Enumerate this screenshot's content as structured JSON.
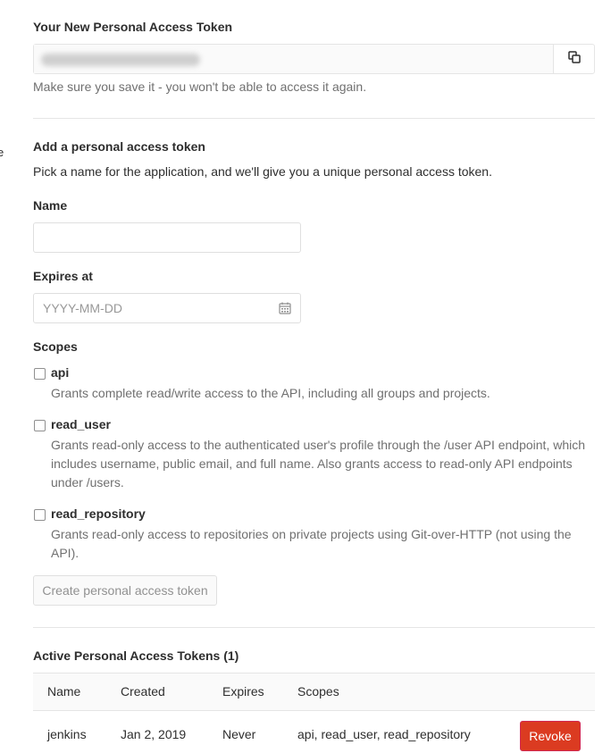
{
  "left_edge_text": "e",
  "new_token": {
    "title": "Your New Personal Access Token",
    "hint": "Make sure you save it - you won't be able to access it again."
  },
  "add_token": {
    "title": "Add a personal access token",
    "description": "Pick a name for the application, and we'll give you a unique personal access token.",
    "name_label": "Name",
    "name_value": "",
    "expires_label": "Expires at",
    "expires_placeholder": "YYYY-MM-DD",
    "scopes_label": "Scopes",
    "scopes": [
      {
        "name": "api",
        "description": "Grants complete read/write access to the API, including all groups and projects."
      },
      {
        "name": "read_user",
        "description": "Grants read-only access to the authenticated user's profile through the /user API endpoint, which includes username, public email, and full name. Also grants access to read-only API endpoints under /users."
      },
      {
        "name": "read_repository",
        "description": "Grants read-only access to repositories on private projects using Git-over-HTTP (not using the API)."
      }
    ],
    "create_button": "Create personal access token"
  },
  "active_tokens": {
    "title": "Active Personal Access Tokens (1)",
    "columns": [
      "Name",
      "Created",
      "Expires",
      "Scopes"
    ],
    "rows": [
      {
        "name": "jenkins",
        "created": "Jan 2, 2019",
        "expires": "Never",
        "scopes": "api, read_user, read_repository",
        "action": "Revoke"
      }
    ]
  },
  "colors": {
    "revoke_bg": "#db3b21",
    "border": "#e5e5e5",
    "muted_text": "#707070"
  },
  "icons": {
    "copy": "copy-icon",
    "calendar": "calendar-icon"
  }
}
